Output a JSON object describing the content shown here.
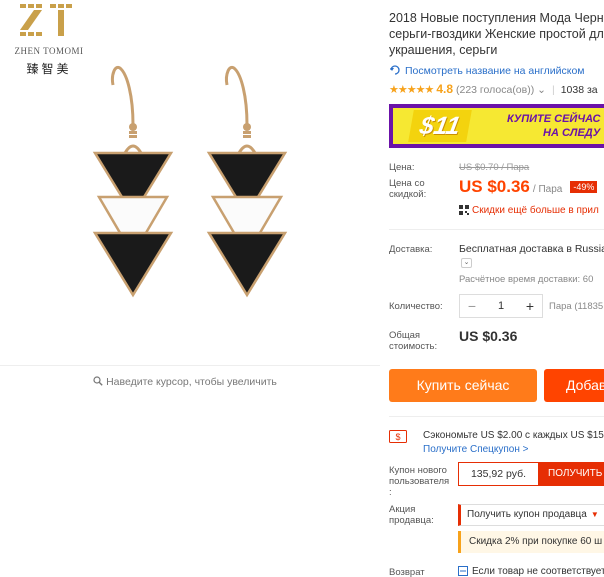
{
  "brand": {
    "monogram": "ZT",
    "name": "ZHEN TOMOMI",
    "name_cn": "臻智美"
  },
  "gallery": {
    "zoom_hint": "Наведите курсор, чтобы увеличить",
    "icon": "magnifier-icon"
  },
  "product": {
    "title_line1": "2018 Новые поступления Мода Черн",
    "title_line2": "серьги-гвоздики Женские простой дл",
    "title_line3": "украшения, серьги",
    "translate_link": "Посмотреть название на английском",
    "rating": {
      "stars": "★★★★★",
      "score": "4.8",
      "votes": "(223 голоса(ов))",
      "orders": "1038 за"
    }
  },
  "banner": {
    "amount": "$11",
    "line1": "КУПИТЕ СЕЙЧАС",
    "line2": "НА СЛЕДУ"
  },
  "price": {
    "label": "Цена:",
    "old": "US $0.70 / Пара",
    "sale_label_1": "Цена со",
    "sale_label_2": "скидкой:",
    "sale": "US $0.36",
    "sale_unit": "/ Пара",
    "discount_badge": "-49%",
    "more_discounts": "Скидки ещё больше в прил"
  },
  "shipping": {
    "label": "Доставка:",
    "value": "Бесплатная доставка в Russia",
    "dropdown": "⌄",
    "estimate": "Расчётное время доставки: 60"
  },
  "quantity": {
    "label": "Количество:",
    "minus": "−",
    "value": "1",
    "plus": "+",
    "available": "Пара (11835"
  },
  "total": {
    "label_1": "Общая",
    "label_2": "стоимость:",
    "value": "US $0.36"
  },
  "actions": {
    "buy_now": "Купить сейчас",
    "add_to_cart": "Добав"
  },
  "coupons": {
    "save_text": "Сэкономьте US $2.00 с каждых US $15.",
    "save_link": "Получите Спецкупон >",
    "new_user_label_1": "Купон нового",
    "new_user_label_2": "пользователя",
    "new_user_label_3": ":",
    "new_user_value": "135,92 руб.",
    "new_user_button": "ПОЛУЧИТЬ",
    "seller_label_1": "Акция",
    "seller_label_2": "продавца:",
    "seller_select": "Получить купон продавца",
    "seller_promo": "Скидка 2% при покупке 60 ш"
  },
  "returns": {
    "label": "Возврат",
    "value": "Если товар не соответствует"
  },
  "colors": {
    "accent_orange": "#ff7b1a",
    "accent_red": "#e62e04",
    "price_red": "#ff4400",
    "link_blue": "#2a6fc9",
    "star_yellow": "#f7a21b",
    "banner_purple": "#6b12a8",
    "banner_yellow": "#f6e832"
  }
}
